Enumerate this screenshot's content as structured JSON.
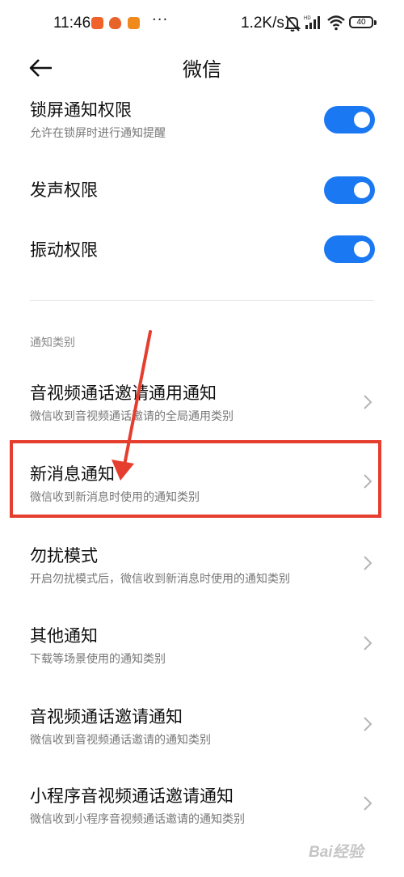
{
  "status_bar": {
    "time": "11:46",
    "net_speed": "1.2K/s",
    "battery": "40",
    "more_dots": "···",
    "icons": [
      "video-app-icon",
      "taobao-icon",
      "mi-app-icon",
      "mute-icon",
      "hd-signal-icon",
      "wifi-icon",
      "battery-icon"
    ]
  },
  "header": {
    "title": "微信",
    "back_icon": "arrow-left-icon"
  },
  "toggles": [
    {
      "title": "锁屏通知权限",
      "subtitle": "允许在锁屏时进行通知提醒",
      "on": true
    },
    {
      "title": "发声权限",
      "on": true
    },
    {
      "title": "振动权限",
      "on": true
    }
  ],
  "section": {
    "header": "通知类别"
  },
  "categories": [
    {
      "title": "音视频通话邀请通用通知",
      "subtitle": "微信收到音视频通话邀请的全局通用类别"
    },
    {
      "title": "新消息通知",
      "subtitle": "微信收到新消息时使用的通知类别"
    },
    {
      "title": "勿扰模式",
      "subtitle": "开启勿扰模式后，微信收到新消息时使用的通知类别"
    },
    {
      "title": "其他通知",
      "subtitle": "下载等场景使用的通知类别"
    },
    {
      "title": "音视频通话邀请通知",
      "subtitle": "微信收到音视频通话邀请的通知类别"
    },
    {
      "title": "小程序音视频通话邀请通知",
      "subtitle": "微信收到小程序音视频通话邀请的通知类别"
    }
  ],
  "colors": {
    "switch_on": "#1a78f2",
    "annotation_red": "#e53e2f"
  },
  "watermark": {
    "text": "Bai经验"
  }
}
